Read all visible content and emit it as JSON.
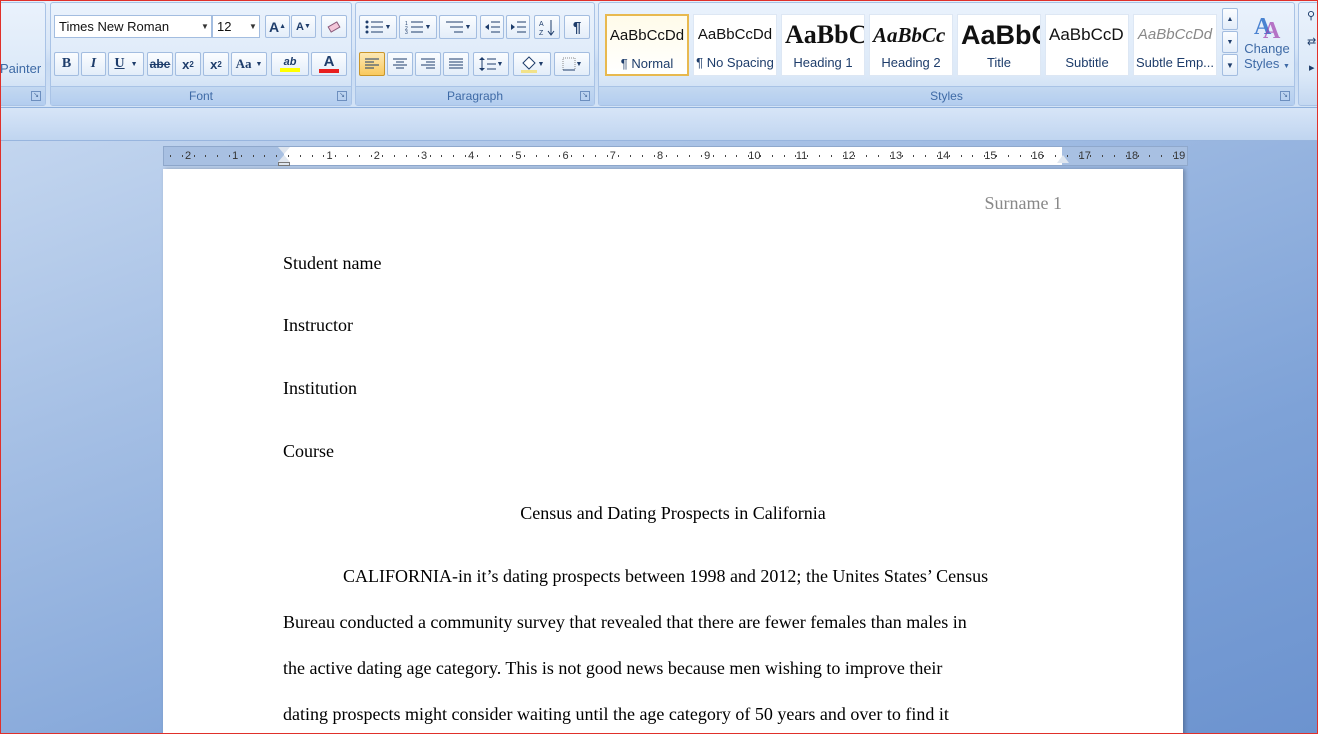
{
  "clipboard": {
    "painter_label": "Painter"
  },
  "font": {
    "group_label": "Font",
    "family": "Times New Roman",
    "size": "12",
    "grow": "A",
    "shrink": "A",
    "bold": "B",
    "italic": "I",
    "underline": "U",
    "strike": "abe",
    "subscript": "x",
    "superscript": "x",
    "change_case": "Aa",
    "highlight": "ab",
    "font_color": "A",
    "highlight_color": "#ffff00",
    "font_color_value": "#e81f1f"
  },
  "paragraph": {
    "group_label": "Paragraph",
    "show_marks": "¶"
  },
  "styles": {
    "group_label": "Styles",
    "tiles": [
      {
        "preview": "AaBbCcDd",
        "name": "¶ Normal"
      },
      {
        "preview": "AaBbCcDd",
        "name": "¶ No Spacing"
      },
      {
        "preview": "AaBbC",
        "name": "Heading 1"
      },
      {
        "preview": "AaBbCc",
        "name": "Heading 2"
      },
      {
        "preview": "AaBbC",
        "name": "Title"
      },
      {
        "preview": "AaBbCcD",
        "name": "Subtitle"
      },
      {
        "preview": "AaBbCcDd",
        "name": "Subtle Emp..."
      }
    ],
    "change_styles_line1": "Change",
    "change_styles_line2": "Styles"
  },
  "ruler": {
    "ticks": [
      "2",
      "1",
      "1",
      "2",
      "3",
      "4",
      "5",
      "6",
      "7",
      "8",
      "9",
      "10",
      "11",
      "12",
      "13",
      "14",
      "15",
      "16",
      "17",
      "18",
      "19"
    ]
  },
  "document": {
    "header": "Surname 1",
    "lines": [
      "Student name",
      "Instructor",
      "Institution",
      "Course"
    ],
    "title": "Census and Dating Prospects in California",
    "body": [
      "CALIFORNIA-in  it’s dating prospects between 1998 and 2012; the Unites States’ Census",
      "Bureau conducted a community survey that revealed that there are fewer females than males in",
      "the active dating age category. This is not good news because men wishing to improve their",
      "dating prospects might consider waiting until the age category of 50 years and over to find it"
    ]
  },
  "colors": {
    "accent": "#3e6aa6",
    "selected_style_border": "#e8b94f"
  }
}
